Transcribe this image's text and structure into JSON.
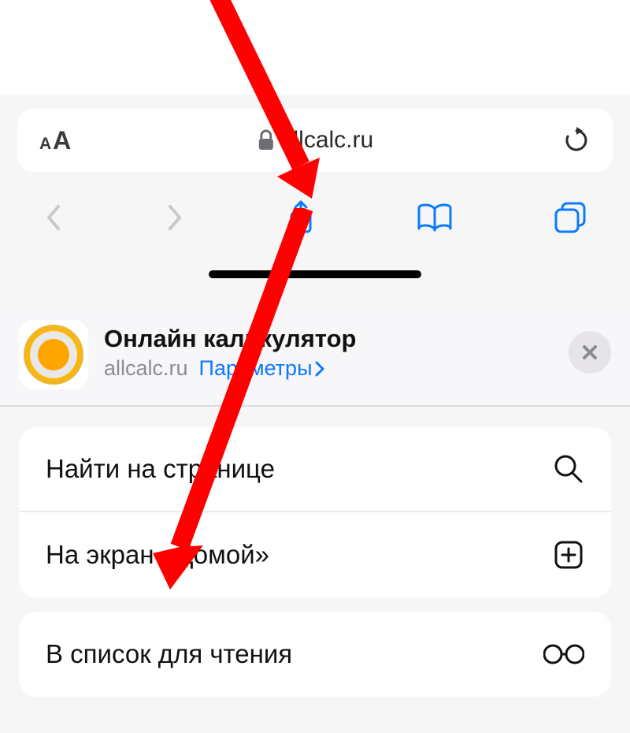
{
  "address_bar": {
    "url": "allcalc.ru"
  },
  "share_sheet": {
    "title": "Онлайн калькулятор",
    "domain": "allcalc.ru",
    "params_label": "Параметры"
  },
  "actions": {
    "find_on_page": "Найти на странице",
    "add_to_home": "На экран «Домой»",
    "reading_list": "В список для чтения"
  }
}
